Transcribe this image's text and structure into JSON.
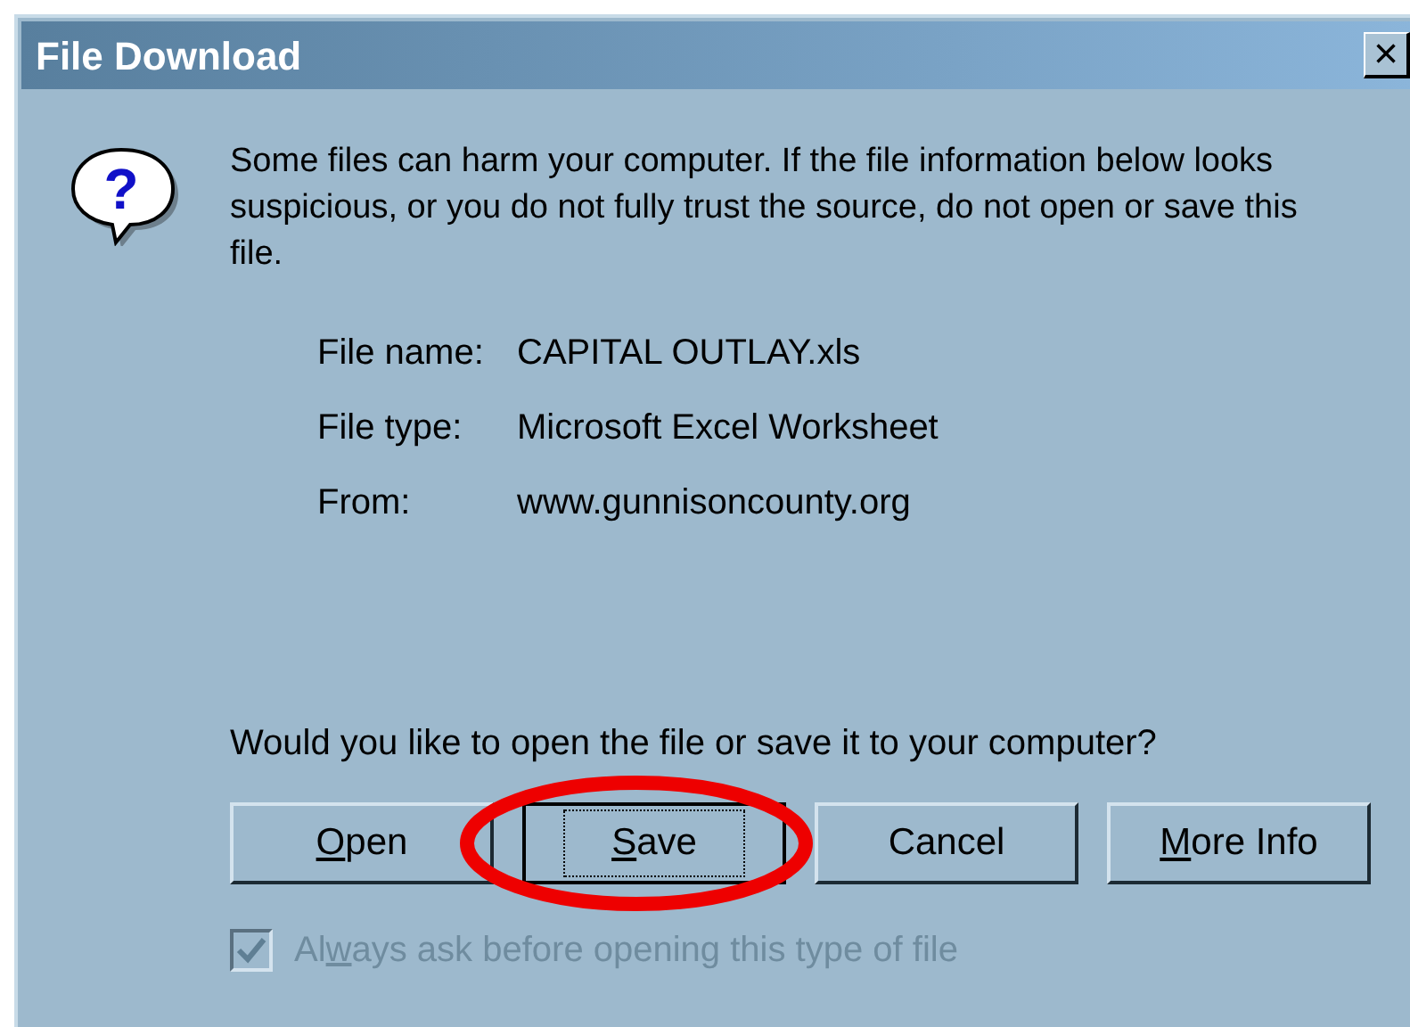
{
  "window": {
    "title": "File Download",
    "close": "×"
  },
  "icon_glyph": "?",
  "message": "Some files can harm your computer. If the file information below looks suspicious, or you do not fully trust the source, do not open or save this file.",
  "details": [
    {
      "label": "File name:",
      "value": "CAPITAL OUTLAY.xls"
    },
    {
      "label": "File type:",
      "value": "Microsoft Excel Worksheet"
    },
    {
      "label": "From:",
      "value": "www.gunnisoncounty.org"
    }
  ],
  "question": "Would you like to open the file or save it to your computer?",
  "buttons": [
    {
      "key": "O",
      "after": "pen",
      "default": false,
      "highlighted": false
    },
    {
      "key": "S",
      "after": "ave",
      "default": true,
      "highlighted": true
    },
    {
      "before": "Cancel",
      "default": false,
      "highlighted": false
    },
    {
      "key": "M",
      "after": "ore Info",
      "default": false,
      "highlighted": false
    }
  ],
  "checkbox": {
    "before": "Al",
    "key": "w",
    "after": "ays ask before opening this type of file",
    "checked": true,
    "disabled": true
  }
}
